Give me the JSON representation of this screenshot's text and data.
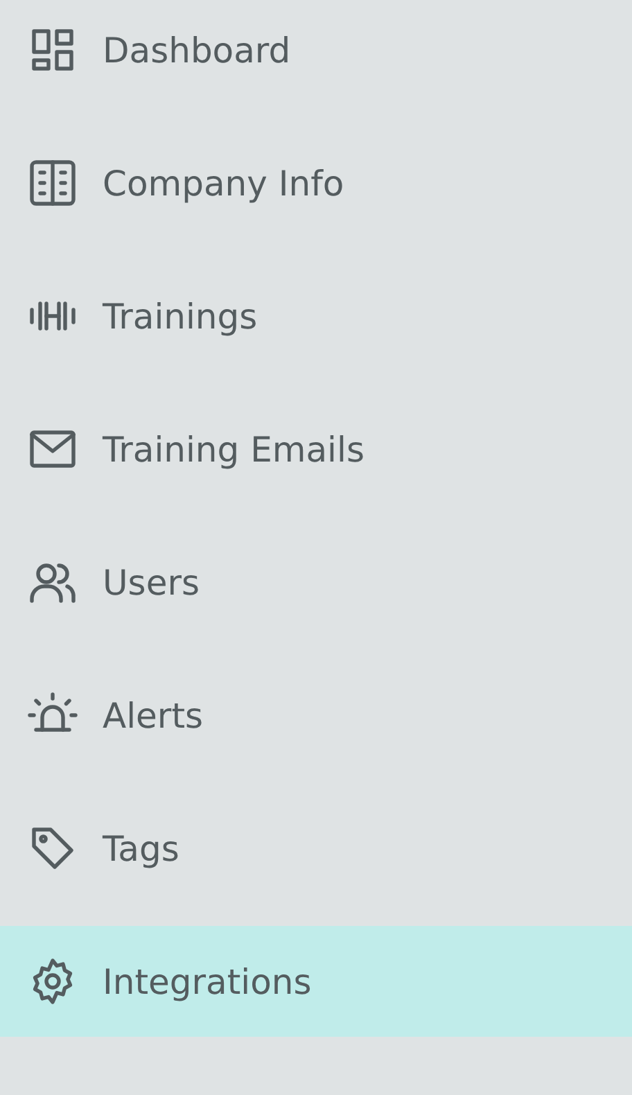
{
  "sidebar": {
    "items": [
      {
        "label": "Dashboard",
        "kind": "dashboard",
        "selected": false
      },
      {
        "label": "Company Info",
        "kind": "building",
        "selected": false
      },
      {
        "label": "Trainings",
        "kind": "dumbbell",
        "selected": false
      },
      {
        "label": "Training Emails",
        "kind": "mail",
        "selected": false
      },
      {
        "label": "Users",
        "kind": "users",
        "selected": false
      },
      {
        "label": "Alerts",
        "kind": "siren",
        "selected": false
      },
      {
        "label": "Tags",
        "kind": "tag",
        "selected": false
      },
      {
        "label": "Integrations",
        "kind": "gear",
        "selected": true
      }
    ]
  }
}
